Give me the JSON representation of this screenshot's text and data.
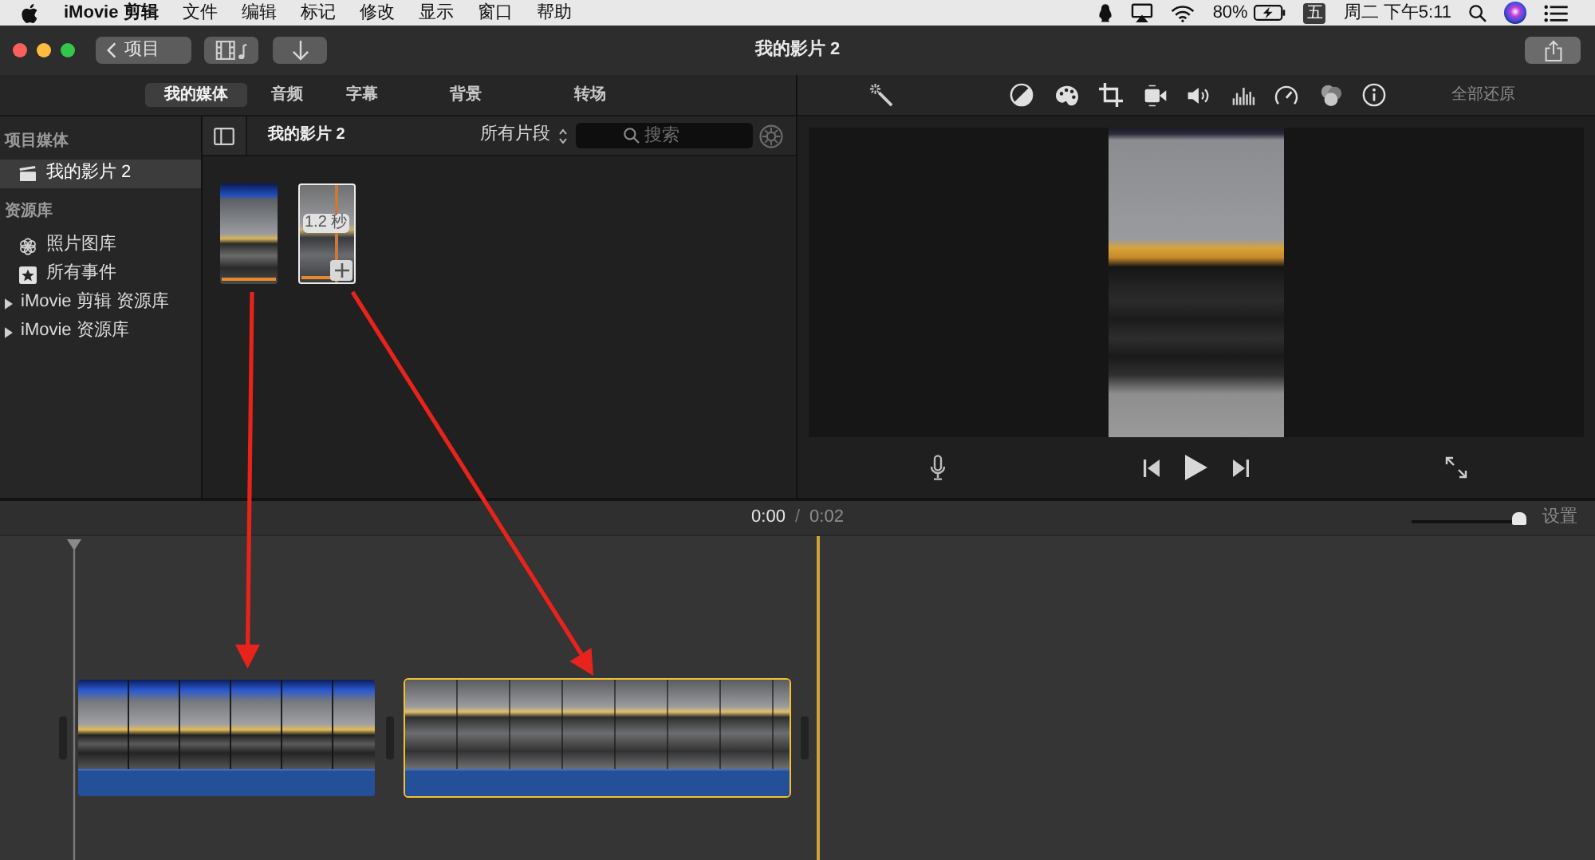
{
  "menu_bar": {
    "app_name": "iMovie 剪辑",
    "menus": [
      "文件",
      "编辑",
      "标记",
      "修改",
      "显示",
      "窗口",
      "帮助"
    ],
    "battery": "80%",
    "input_method": "五",
    "clock": "周二 下午5:11"
  },
  "toolbar": {
    "back_button": "项目",
    "title": "我的影片 2"
  },
  "browser_tabs": [
    {
      "label": "我的媒体",
      "selected": true
    },
    {
      "label": "音频",
      "selected": false
    },
    {
      "label": "字幕",
      "selected": false
    },
    {
      "label": "背景",
      "selected": false
    },
    {
      "label": "转场",
      "selected": false
    }
  ],
  "adjustments": {
    "reset_button": "全部还原"
  },
  "sidebar": {
    "project_heading": "项目媒体",
    "projects": [
      {
        "label": "我的影片 2",
        "selected": true
      }
    ],
    "library_heading": "资源库",
    "sources": [
      {
        "label": "照片图库",
        "kind": "photos",
        "selected": false
      },
      {
        "label": "所有事件",
        "kind": "events",
        "selected": false
      }
    ],
    "libraries": [
      {
        "label": "iMovie 剪辑 资源库",
        "expanded": false,
        "selected": false
      },
      {
        "label": "iMovie 资源库",
        "expanded": false,
        "selected": false
      }
    ]
  },
  "media_browser": {
    "title": "我的影片 2",
    "filter": "所有片段",
    "search": {
      "placeholder": "搜索"
    },
    "clips": [
      {
        "selected": false,
        "used": true
      },
      {
        "selected": true,
        "used": true,
        "duration": "1.2 秒"
      }
    ]
  },
  "timeline": {
    "current_time": "0:00",
    "separator": "/",
    "total_time": "0:02",
    "zoom": {
      "level": 1
    },
    "settings_button": "设置",
    "clips": [
      {
        "selected": false
      },
      {
        "selected": true
      }
    ]
  }
}
